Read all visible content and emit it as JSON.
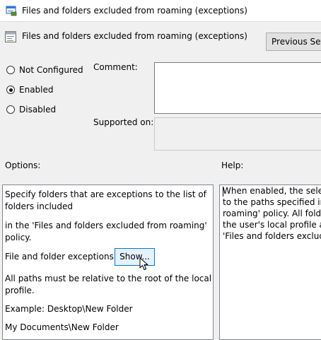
{
  "window": {
    "title": "Files and folders excluded from roaming (exceptions)"
  },
  "header": {
    "title": "Files and folders excluded from roaming (exceptions)",
    "previous_setting_label": "Previous Setti"
  },
  "state": {
    "options": [
      {
        "label": "Not Configured",
        "selected": false
      },
      {
        "label": "Enabled",
        "selected": true
      },
      {
        "label": "Disabled",
        "selected": false
      }
    ]
  },
  "comment": {
    "label": "Comment:",
    "value": ""
  },
  "supported_on": {
    "label": "Supported on:",
    "value": ""
  },
  "options_section": {
    "label": "Options:",
    "description_line1": "Specify folders that are exceptions to the list of",
    "description_line2": "folders included",
    "description_line3": "in the 'Files and folders excluded from roaming'",
    "description_line4": "policy.",
    "exceptions_label": "File and folder exceptions:",
    "show_button": "Show...",
    "paths_note_line1": "All paths must be relative to the root of the local",
    "paths_note_line2": "profile.",
    "example_line": "Example:  Desktop\\New Folder",
    "example_line2": "My Documents\\New Folder"
  },
  "help_section": {
    "label": "Help:",
    "lines": [
      "When enabled, the selecte",
      "to the paths specified in th",
      "roaming' policy. All folder",
      "the user's local profile and",
      "'Files and folders excluded"
    ]
  }
}
